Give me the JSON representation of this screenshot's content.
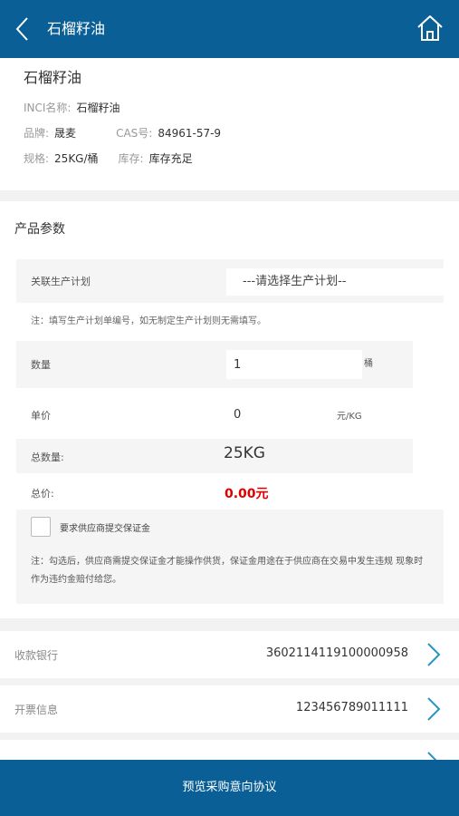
{
  "header": {
    "title": "石榴籽油",
    "back_icon": "back-arrow-icon",
    "home_icon": "home-icon"
  },
  "product": {
    "name": "石榴籽油",
    "inci_label": "INCI名称:",
    "inci_value": "石榴籽油",
    "brand_label": "品牌:",
    "brand_value": "晟麦",
    "cas_label": "CAS号:",
    "cas_value": "84961-57-9",
    "spec_label": "规格:",
    "spec_value": "25KG/桶",
    "stock_label": "库存:",
    "stock_value": "库存充足"
  },
  "params": {
    "section_title": "产品参数",
    "plan_label": "关联生产计划",
    "plan_value": "---请选择生产计划--",
    "plan_note": "注：填写生产计划单编号，如无制定生产计划则无需填写。",
    "qty_label": "数量",
    "qty_value": "1",
    "qty_unit": "桶",
    "price_label": "单价",
    "price_value": "0",
    "price_unit": "元/KG",
    "total_qty_label": "总数量:",
    "total_qty_value": "25KG",
    "total_price_label": "总价:",
    "total_price_value": "0.00元",
    "deposit_label": "要求供应商提交保证金",
    "deposit_checked": false,
    "deposit_note": "注：勾选后，供应商需提交保证金才能操作供货，保证金用途在于供应商在交易中发生违规 现象时作为违约金赔付给您。"
  },
  "payment": {
    "bank_label": "收款银行",
    "bank_value": "3602114119100000958",
    "invoice_label": "开票信息",
    "invoice_value": "123456789011111"
  },
  "footer": {
    "button_label": "预览采购意向协议"
  },
  "colors": {
    "primary": "#0a5f97",
    "price": "#e00000",
    "chevron": "#2c93c8"
  }
}
